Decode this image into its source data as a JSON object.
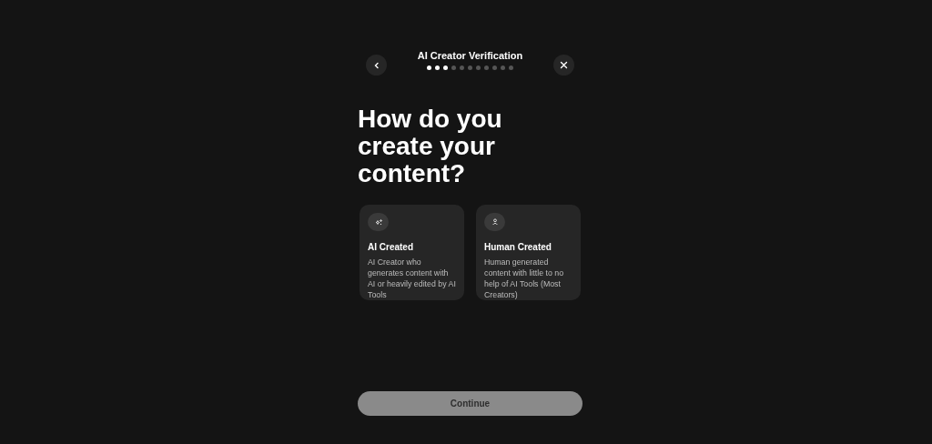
{
  "header": {
    "title": "AI Creator Verification"
  },
  "progress": [
    {
      "active": true
    },
    {
      "active": true
    },
    {
      "active": true
    },
    {
      "active": false
    },
    {
      "active": false
    },
    {
      "active": false
    },
    {
      "active": false
    },
    {
      "active": false
    },
    {
      "active": false
    },
    {
      "active": false
    },
    {
      "active": false
    }
  ],
  "heading": "How do you create your content?",
  "options": [
    {
      "kind": "ai",
      "title": "AI Created",
      "description": "AI Creator who generates content with AI or heavily edited by AI Tools",
      "selected": false
    },
    {
      "kind": "human",
      "title": "Human Created",
      "description": "Human generated content with little to no help of AI Tools (Most Creators)",
      "selected": false
    }
  ],
  "continue_button": {
    "label": "Continue",
    "disabled": true
  }
}
